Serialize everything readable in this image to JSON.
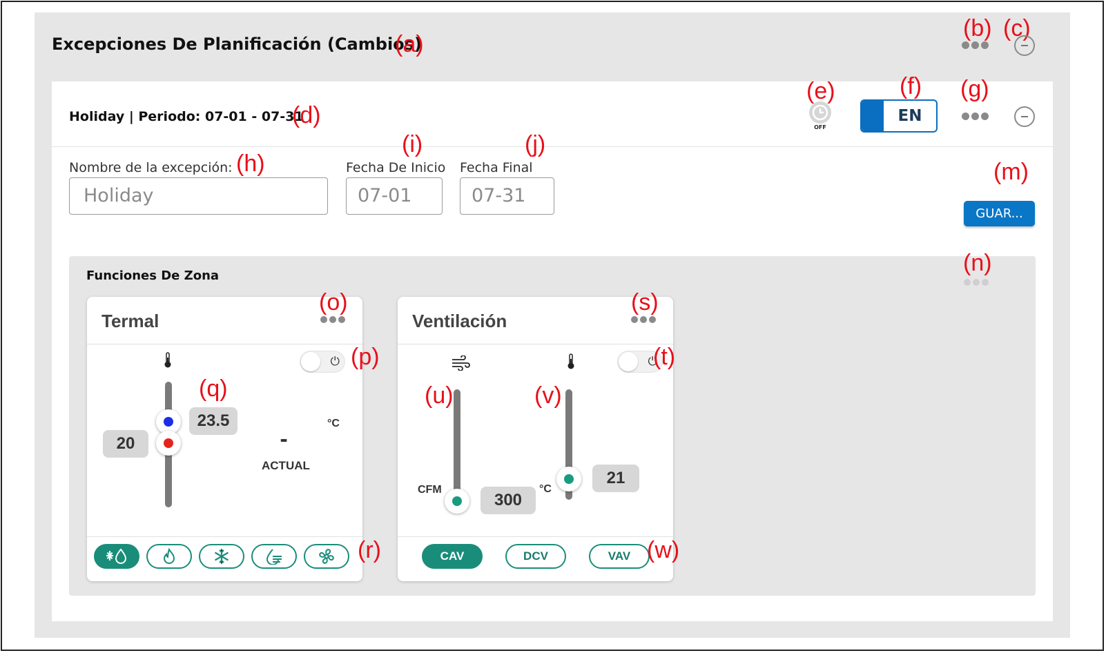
{
  "section": {
    "title": "Excepciones De Planificación (Cambios)"
  },
  "exception": {
    "header": "Holiday | Periodo: 07-01 - 07-31",
    "schedule_badge": "OFF",
    "enable_toggle": "EN",
    "name_label": "Nombre de la excepción:",
    "name_value": "Holiday",
    "start_label": "Fecha De Inicio",
    "start_value": "07-01",
    "end_label": "Fecha Final",
    "end_value": "07-31",
    "save_label": "GUAR..."
  },
  "zone": {
    "title": "Funciones De Zona",
    "thermal": {
      "title": "Termal",
      "cool_setpoint": "23.5",
      "heat_setpoint": "20",
      "unit": "°C",
      "actual_value": "-",
      "actual_label": "ACTUAL",
      "modes": [
        {
          "icon": "auto-mode-icon",
          "active": true
        },
        {
          "icon": "flame-icon",
          "active": false
        },
        {
          "icon": "snowflake-icon",
          "active": false
        },
        {
          "icon": "dehumidify-icon",
          "active": false
        },
        {
          "icon": "fan-icon",
          "active": false
        }
      ]
    },
    "ventilation": {
      "title": "Ventilación",
      "flow_unit": "CFM",
      "flow_value": "300",
      "temp_unit": "°C",
      "temp_value": "21",
      "modes": [
        {
          "label": "CAV",
          "active": true
        },
        {
          "label": "DCV",
          "active": false
        },
        {
          "label": "VAV",
          "active": false
        }
      ]
    }
  },
  "annotations": {
    "a": "(a)",
    "b": "(b)",
    "c": "(c)",
    "d": "(d)",
    "e": "(e)",
    "f": "(f)",
    "g": "(g)",
    "h": "(h)",
    "i": "(i)",
    "j": "(j)",
    "m": "(m)",
    "n": "(n)",
    "o": "(o)",
    "p": "(p)",
    "q": "(q)",
    "r": "(r)",
    "s": "(s)",
    "t": "(t)",
    "u": "(u)",
    "v": "(v)",
    "w": "(w)"
  },
  "colors": {
    "primary_blue": "#0a76c6",
    "teal": "#1a8d7a",
    "cool_dot": "#1a2ee8",
    "heat_dot": "#e8231a",
    "annotation": "#e8101a"
  }
}
